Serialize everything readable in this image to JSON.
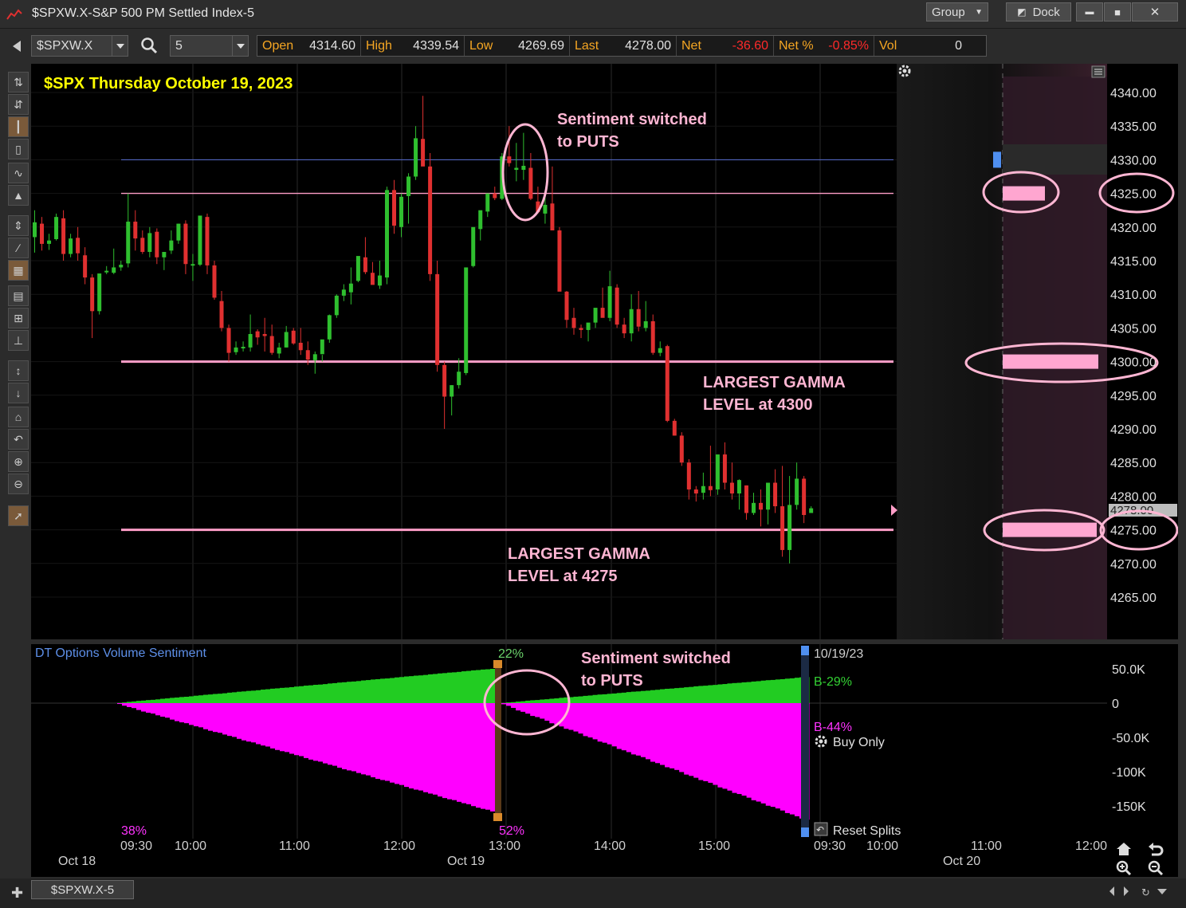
{
  "window": {
    "title": "$SPXW.X-S&P 500 PM Settled Index-5",
    "buttons": {
      "group": "Group",
      "dock": "Dock",
      "minimize": "▬",
      "maximize": "■",
      "close": "✕"
    }
  },
  "toolbar": {
    "symbol": "$SPXW.X",
    "interval": "5",
    "quote": {
      "open_label": "Open",
      "open": "4314.60",
      "high_label": "High",
      "high": "4339.54",
      "low_label": "Low",
      "low": "4269.69",
      "last_label": "Last",
      "last": "4278.00",
      "net_label": "Net",
      "net": "-36.60",
      "netpct_label": "Net %",
      "netpct": "-0.85%",
      "vol_label": "Vol",
      "vol": "0"
    }
  },
  "chart": {
    "heading": "$SPX Thursday October 19, 2023",
    "annotations": {
      "sentiment_price_1": "Sentiment switched",
      "sentiment_price_2": "to PUTS",
      "gamma4300_1": "LARGEST GAMMA",
      "gamma4300_2": "LEVEL at 4300",
      "gamma4275_1": "LARGEST GAMMA",
      "gamma4275_2": "LEVEL at 4275",
      "sentiment_vol_1": "Sentiment switched",
      "sentiment_vol_2": "to PUTS"
    },
    "price_labels": [
      "4340.00",
      "4335.00",
      "4330.00",
      "4325.00",
      "4320.00",
      "4315.00",
      "4310.00",
      "4305.00",
      "4300.00",
      "4295.00",
      "4290.00",
      "4285.00",
      "4280.00",
      "4275.00",
      "4270.00",
      "4265.00"
    ],
    "last_price_label": "4278.00",
    "vol_panel": {
      "title": "DT Options Volume Sentiment",
      "axis_labels": [
        "50.0K",
        "0",
        "-50.0K",
        "-100K",
        "-150K"
      ],
      "pct_top": "22%",
      "pct_bottom_left": "38%",
      "pct_bottom_mid": "52%",
      "date_label": "10/19/23",
      "b_green": "B-29%",
      "b_magenta": "B-44%",
      "buy_only": "Buy Only",
      "reset_splits": "Reset Splits"
    },
    "time_labels": [
      "09:30",
      "10:00",
      "11:00",
      "12:00",
      "13:00",
      "14:00",
      "15:00",
      "09:30",
      "10:00",
      "11:00",
      "12:00"
    ],
    "date_labels": [
      "Oct 18",
      "Oct 19",
      "Oct 20"
    ],
    "colors": {
      "up": "#2fbf2f",
      "down": "#e03030",
      "gamma": "#ff9ec8",
      "put": "#ff00ff",
      "call": "#22cc22",
      "heading": "#ffff00"
    }
  },
  "chart_data": {
    "type": "candlestick",
    "title": "$SPX Thursday October 19, 2023",
    "interval_minutes": 5,
    "y_range": [
      4261,
      4343
    ],
    "horizontal_levels": [
      4330,
      4325,
      4300,
      4275
    ],
    "gamma_levels": [
      4325,
      4300,
      4275
    ],
    "candles_ohlc": [
      [
        4318.5,
        4322.5,
        4316.2,
        4320.7
      ],
      [
        4320.5,
        4321.5,
        4316.5,
        4317.5
      ],
      [
        4317.5,
        4319.0,
        4316.6,
        4318.0
      ],
      [
        4318.2,
        4322.0,
        4318.0,
        4321.5
      ],
      [
        4321.3,
        4322.5,
        4315.0,
        4316.0
      ],
      [
        4316.0,
        4319.0,
        4315.5,
        4318.3
      ],
      [
        4318.4,
        4320.0,
        4315.0,
        4316.1
      ],
      [
        4315.8,
        4317.0,
        4311.5,
        4312.5
      ],
      [
        4312.5,
        4313.0,
        4303.5,
        4307.5
      ],
      [
        4307.5,
        4313.0,
        4307.0,
        4313.1
      ],
      [
        4313.3,
        4314.2,
        4313.0,
        4313.5
      ],
      [
        4313.2,
        4316.8,
        4313.0,
        4314.0
      ],
      [
        4314.0,
        4315.0,
        4313.5,
        4314.4
      ],
      [
        4314.6,
        4325.0,
        4314.0,
        4320.8
      ],
      [
        4320.8,
        4322.5,
        4316.5,
        4318.3
      ],
      [
        4318.4,
        4319.5,
        4316.0,
        4316.3
      ],
      [
        4316.3,
        4320.0,
        4315.5,
        4319.1
      ],
      [
        4319.3,
        4319.8,
        4314.5,
        4315.5
      ],
      [
        4315.5,
        4316.3,
        4313.6,
        4316.3
      ],
      [
        4316.5,
        4319.5,
        4316.0,
        4318.0
      ],
      [
        4318.0,
        4320.5,
        4317.5,
        4320.5
      ],
      [
        4320.5,
        4321.0,
        4313.0,
        4314.5
      ],
      [
        4314.5,
        4316.0,
        4312.0,
        4314.5
      ],
      [
        4314.4,
        4321.5,
        4314.2,
        4321.7
      ],
      [
        4321.5,
        4322.0,
        4313.0,
        4314.3
      ],
      [
        4314.3,
        4315.0,
        4309.2,
        4309.5
      ],
      [
        4309.0,
        4310.5,
        4304.5,
        4305.0
      ],
      [
        4305.0,
        4305.5,
        4300.0,
        4301.3
      ],
      [
        4301.4,
        4303.0,
        4301.0,
        4302.1
      ],
      [
        4302.2,
        4303.0,
        4301.5,
        4302.2
      ],
      [
        4302.1,
        4307.0,
        4301.5,
        4304.1
      ],
      [
        4304.5,
        4304.8,
        4302.5,
        4303.6
      ],
      [
        4304.1,
        4306.5,
        4301.5,
        4303.8
      ],
      [
        4303.8,
        4305.5,
        4301.0,
        4301.3
      ],
      [
        4301.2,
        4302.8,
        4300.5,
        4302.1
      ],
      [
        4302.1,
        4305.3,
        4302.1,
        4304.4
      ],
      [
        4304.6,
        4305.0,
        4302.5,
        4302.7
      ],
      [
        4302.8,
        4305.0,
        4301.0,
        4301.7
      ],
      [
        4301.7,
        4303.0,
        4299.5,
        4300.3
      ],
      [
        4300.2,
        4301.5,
        4298.2,
        4301.1
      ],
      [
        4301.1,
        4301.0,
        4300.0,
        4303.3
      ],
      [
        4303.3,
        4307.0,
        4302.8,
        4306.9
      ],
      [
        4306.9,
        4310.0,
        4306.5,
        4309.8
      ],
      [
        4309.8,
        4311.5,
        4309.0,
        4310.7
      ],
      [
        4310.3,
        4314.0,
        4308.5,
        4311.6
      ],
      [
        4312.0,
        4315.5,
        4311.8,
        4315.7
      ],
      [
        4315.5,
        4318.5,
        4313.0,
        4313.3
      ],
      [
        4313.2,
        4314.8,
        4311.5,
        4311.4
      ],
      [
        4311.3,
        4315.0,
        4310.8,
        4312.8
      ],
      [
        4312.5,
        4326.0,
        4311.5,
        4325.5
      ],
      [
        4325.5,
        4327.0,
        4319.0,
        4320.2
      ],
      [
        4320.0,
        4325.0,
        4318.5,
        4324.5
      ],
      [
        4324.6,
        4328.0,
        4320.5,
        4327.5
      ],
      [
        4327.5,
        4335.0,
        4327.0,
        4333.2
      ],
      [
        4333.1,
        4339.5,
        4330.0,
        4329.0
      ],
      [
        4329.0,
        4331.0,
        4312.0,
        4313.0
      ],
      [
        4313.0,
        4315.0,
        4298.5,
        4299.5
      ],
      [
        4299.5,
        4300.0,
        4290.0,
        4294.8
      ],
      [
        4294.8,
        4296.5,
        4292.0,
        4296.5
      ],
      [
        4296.5,
        4300.5,
        4296.0,
        4298.5
      ],
      [
        4298.3,
        4313.5,
        4298.0,
        4314.0
      ],
      [
        4314.2,
        4315.5,
        4314.0,
        4320.0
      ],
      [
        4319.7,
        4321.5,
        4318.0,
        4322.5
      ],
      [
        4322.3,
        4324.5,
        4321.5,
        4325.0
      ],
      [
        4325.0,
        4326.0,
        4324.0,
        4324.3
      ],
      [
        4324.2,
        4331.0,
        4324.0,
        4330.5
      ],
      [
        4330.5,
        4335.0,
        4329.0,
        4329.5
      ],
      [
        4328.5,
        4332.5,
        4326.8,
        4328.8
      ],
      [
        4328.5,
        4334.0,
        4327.0,
        4329.1
      ],
      [
        4328.8,
        4331.0,
        4324.0,
        4324.2
      ],
      [
        4323.8,
        4326.0,
        4322.0,
        4322.2
      ],
      [
        4322.0,
        4324.5,
        4320.5,
        4323.3
      ],
      [
        4323.5,
        4329.0,
        4319.5,
        4319.5
      ],
      [
        4319.5,
        4320.0,
        4313.0,
        4310.4
      ],
      [
        4310.4,
        4310.5,
        4305.0,
        4306.2
      ],
      [
        4306.5,
        4308.0,
        4304.0,
        4305.0
      ],
      [
        4305.0,
        4305.5,
        4303.5,
        4304.7
      ],
      [
        4304.7,
        4305.5,
        4303.0,
        4305.8
      ],
      [
        4305.8,
        4307.0,
        4305.0,
        4308.0
      ],
      [
        4308.0,
        4311.0,
        4307.0,
        4306.5
      ],
      [
        4306.5,
        4313.5,
        4306.0,
        4311.2
      ],
      [
        4311.0,
        4311.5,
        4305.0,
        4305.5
      ],
      [
        4305.5,
        4306.5,
        4303.5,
        4304.2
      ],
      [
        4304.2,
        4310.0,
        4303.0,
        4307.8
      ],
      [
        4307.8,
        4310.5,
        4304.5,
        4305.2
      ],
      [
        4305.0,
        4309.0,
        4304.5,
        4306.0
      ],
      [
        4306.0,
        4307.0,
        4301.0,
        4301.3
      ],
      [
        4301.3,
        4303.0,
        4300.8,
        4302.0
      ],
      [
        4302.3,
        4302.5,
        4291.0,
        4291.2
      ],
      [
        4291.2,
        4291.5,
        4289.0,
        4289.0
      ],
      [
        4289.0,
        4289.5,
        4284.5,
        4285.0
      ],
      [
        4285.0,
        4285.5,
        4279.5,
        4281.0
      ],
      [
        4281.0,
        4281.5,
        4279.2,
        4280.4
      ],
      [
        4280.5,
        4283.5,
        4279.5,
        4281.5
      ],
      [
        4281.5,
        4287.5,
        4280.0,
        4280.9
      ],
      [
        4281.0,
        4286.0,
        4280.2,
        4286.2
      ],
      [
        4286.2,
        4288.0,
        4281.0,
        4282.0
      ],
      [
        4282.0,
        4285.0,
        4279.5,
        4280.4
      ],
      [
        4280.4,
        4282.5,
        4278.0,
        4282.4
      ],
      [
        4281.6,
        4281.6,
        4276.5,
        4277.5
      ],
      [
        4277.5,
        4280.5,
        4277.2,
        4279.0
      ],
      [
        4279.0,
        4281.0,
        4275.5,
        4278.0
      ],
      [
        4278.0,
        4280.5,
        4275.8,
        4282.0
      ],
      [
        4282.0,
        4284.0,
        4277.5,
        4278.5
      ],
      [
        4278.5,
        4284.5,
        4271.0,
        4272.0
      ],
      [
        4272.0,
        4283.0,
        4270.0,
        4278.7
      ],
      [
        4278.7,
        4285.0,
        4278.0,
        4282.6
      ],
      [
        4282.6,
        4283.0,
        4276.0,
        4277.2
      ],
      [
        4277.5,
        4278.5,
        4277.5,
        4278.2
      ]
    ],
    "volume_sentiment": {
      "legend": "DT Options Volume Sentiment",
      "y_ticks": [
        "50.0K",
        "0",
        "-50.0K",
        "-100K",
        "-150K"
      ],
      "calls_min_K": 0,
      "calls_max_K": 50,
      "puts_min_K": -170,
      "puts_max_K": 0,
      "reset_time": "13:00"
    }
  }
}
